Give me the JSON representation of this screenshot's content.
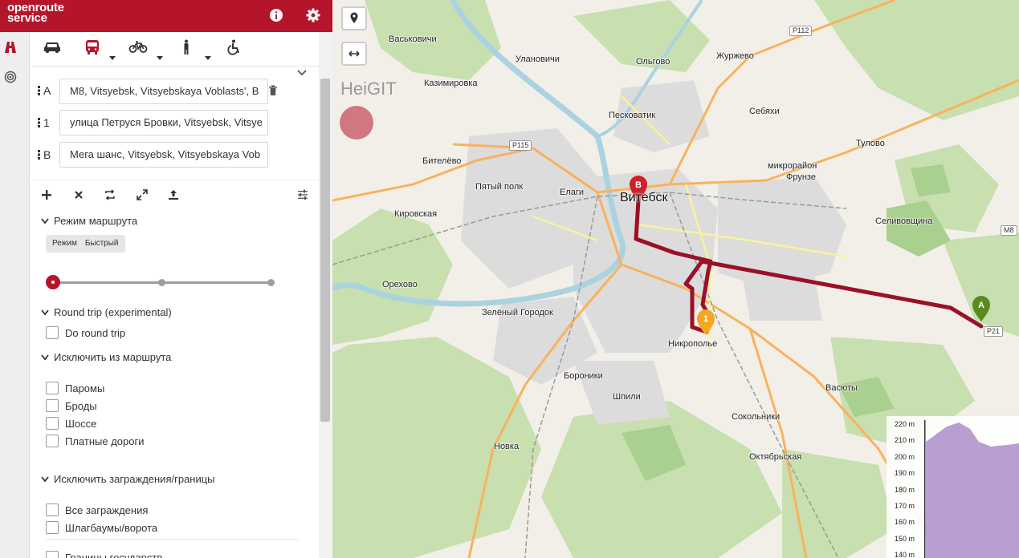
{
  "header": {
    "logo_line1": "openroute",
    "logo_line2": "service",
    "info_icon": "info-icon",
    "settings_icon": "gear-icon"
  },
  "sidebar_strip": {
    "icons": [
      "route-icon",
      "isochrone-icon"
    ]
  },
  "profiles": {
    "items": [
      "car",
      "bus",
      "bike",
      "pedestrian",
      "wheelchair"
    ],
    "selected": "bus"
  },
  "waypoints": [
    {
      "label": "A",
      "value": "M8, Vitsyebsk, Vitsyebskaya Voblasts', B"
    },
    {
      "label": "1",
      "value": "улица Петруся Бровки, Vitsyebsk, Vitsye"
    },
    {
      "label": "B",
      "value": "Мега шанс, Vitsyebsk, Vitsyebskaya Vob"
    }
  ],
  "route_mode": {
    "title": "Режим маршрута",
    "chip_label": "Режим",
    "chip_value": "Быстрый",
    "slider_level": 0.0
  },
  "round_trip": {
    "title": "Round trip (experimental)",
    "option": "Do round trip"
  },
  "exclude": {
    "title": "Исключить из маршрута",
    "options": [
      "Паромы",
      "Броды",
      "Шоссе",
      "Платные дороги"
    ]
  },
  "exclude_barriers": {
    "title": "Исключить заграждения/границы",
    "options": [
      "Все заграждения",
      "Шлагбаумы/ворота",
      "Границы государств"
    ]
  },
  "map": {
    "city": "Витебск",
    "heigit_text": "HeiGIT",
    "places": [
      "Васьковичи",
      "Казимировка",
      "Улановичи",
      "Ольгово",
      "Журжево",
      "Песковатик",
      "Себяхи",
      "Тулово",
      "Бителёво",
      "микрорайон",
      "Фрунзе",
      "Пятый полк",
      "Елаги",
      "Кировская",
      "Селивовщина",
      "Орехово",
      "Витебск",
      "Зелёный Городок",
      "Никрополье",
      "Васюты",
      "Бороники",
      "Шпили",
      "Сокольники",
      "Новка",
      "Октябрьская"
    ],
    "roads": [
      "P112",
      "P115",
      "M8",
      "P21"
    ],
    "markers": [
      {
        "label": "A",
        "color": "#5a8a1f"
      },
      {
        "label": "1",
        "color": "#f5a623"
      },
      {
        "label": "B",
        "color": "#d0202b"
      }
    ],
    "route_color": "#b5152b"
  },
  "elevation": {
    "ticks": [
      "220 m",
      "210 m",
      "200 m",
      "190 m",
      "180 m",
      "170 m",
      "160 m",
      "150 m",
      "140 m"
    ],
    "fill_color": "#b79fd1"
  },
  "colors": {
    "brand": "#b5152b"
  }
}
